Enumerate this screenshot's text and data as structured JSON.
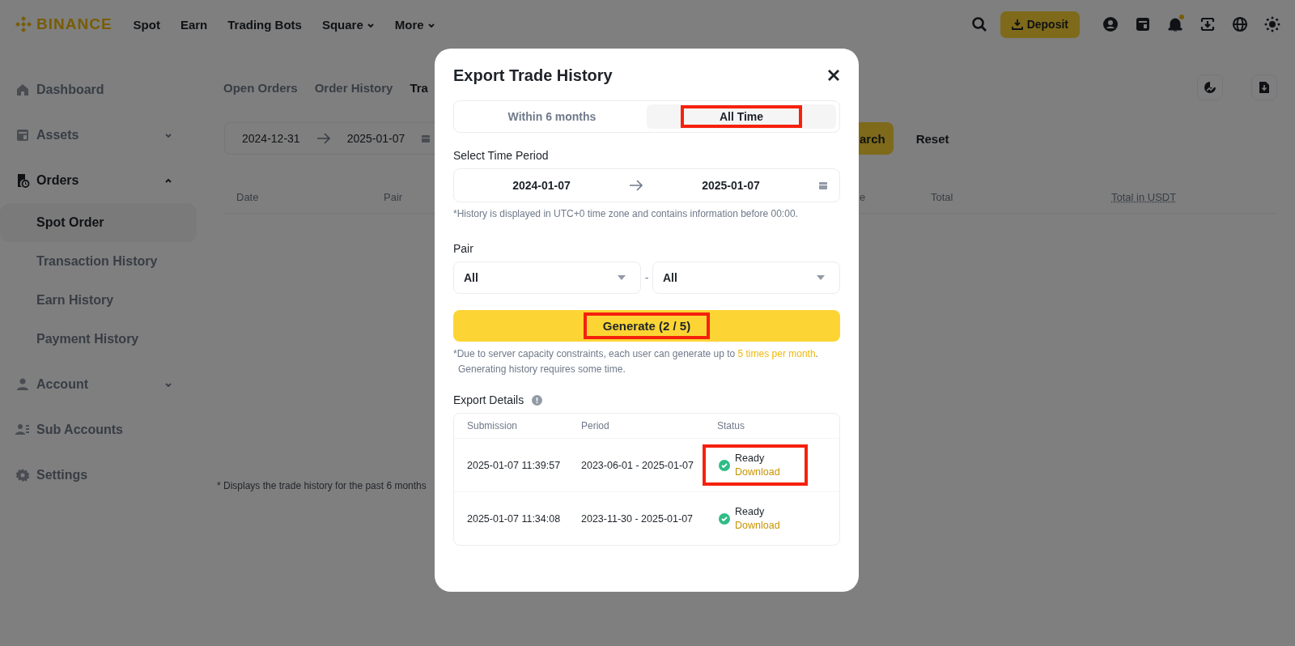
{
  "top_nav": {
    "logo": "BINANCE",
    "items": [
      {
        "label": "Spot",
        "has_menu": false
      },
      {
        "label": "Earn",
        "has_menu": false
      },
      {
        "label": "Trading Bots",
        "has_menu": false
      },
      {
        "label": "Square",
        "has_menu": true
      },
      {
        "label": "More",
        "has_menu": true
      }
    ],
    "deposit_button": "Deposit",
    "has_notification": true
  },
  "sidebar": {
    "items": [
      {
        "label": "Dashboard",
        "kind": "link",
        "selected": false
      },
      {
        "label": "Assets",
        "kind": "group",
        "selected": false,
        "expanded": false
      },
      {
        "label": "Orders",
        "kind": "group",
        "selected": true,
        "expanded": true,
        "children": [
          {
            "label": "Spot Order",
            "selected": true
          },
          {
            "label": "Transaction History",
            "selected": false
          },
          {
            "label": "Earn History",
            "selected": false
          },
          {
            "label": "Payment History",
            "selected": false
          }
        ]
      },
      {
        "label": "Account",
        "kind": "group",
        "selected": false,
        "expanded": false
      },
      {
        "label": "Sub Accounts",
        "kind": "link",
        "selected": false
      },
      {
        "label": "Settings",
        "kind": "link",
        "selected": false
      }
    ]
  },
  "main": {
    "tabs": [
      {
        "label": "Open Orders",
        "selected": false
      },
      {
        "label": "Order History",
        "selected": false
      },
      {
        "label": "Tra",
        "selected": true
      }
    ],
    "date_from": "2024-12-31",
    "date_to": "2025-01-07",
    "search_button": "arch",
    "reset_button": "Reset",
    "columns": [
      "Date",
      "Pair",
      "e",
      "Total",
      "Total in USDT"
    ],
    "footnote": "* Displays the trade history for the past 6 months"
  },
  "modal": {
    "title": "Export Trade History",
    "range_tabs": [
      {
        "label": "Within 6 months",
        "selected": false,
        "highlighted": false
      },
      {
        "label": "All Time",
        "selected": true,
        "highlighted": true
      }
    ],
    "period_label": "Select Time Period",
    "period_from": "2024-01-07",
    "period_to": "2025-01-07",
    "period_note": "*History is displayed in UTC+0 time zone and contains information before 00:00.",
    "pair_label": "Pair",
    "pair_selects": [
      "All",
      "All"
    ],
    "pair_separator": "-",
    "generate_button": {
      "label": "Generate (2 / 5)",
      "highlighted": true
    },
    "generate_note": {
      "before": "*Due to server capacity constraints, each user can generate up to ",
      "link": "5 times per month",
      "after": ". Generating history requires some time."
    },
    "export_details": {
      "title": "Export Details",
      "columns": [
        "Submission",
        "Period",
        "Status"
      ],
      "rows": [
        {
          "submission": "2025-01-07 11:39:57",
          "period": "2023-06-01 - 2025-01-07",
          "status": "Ready",
          "action": "Download",
          "highlighted": true
        },
        {
          "submission": "2025-01-07 11:34:08",
          "period": "2023-11-30 - 2025-01-07",
          "status": "Ready",
          "action": "Download",
          "highlighted": false
        }
      ]
    }
  }
}
